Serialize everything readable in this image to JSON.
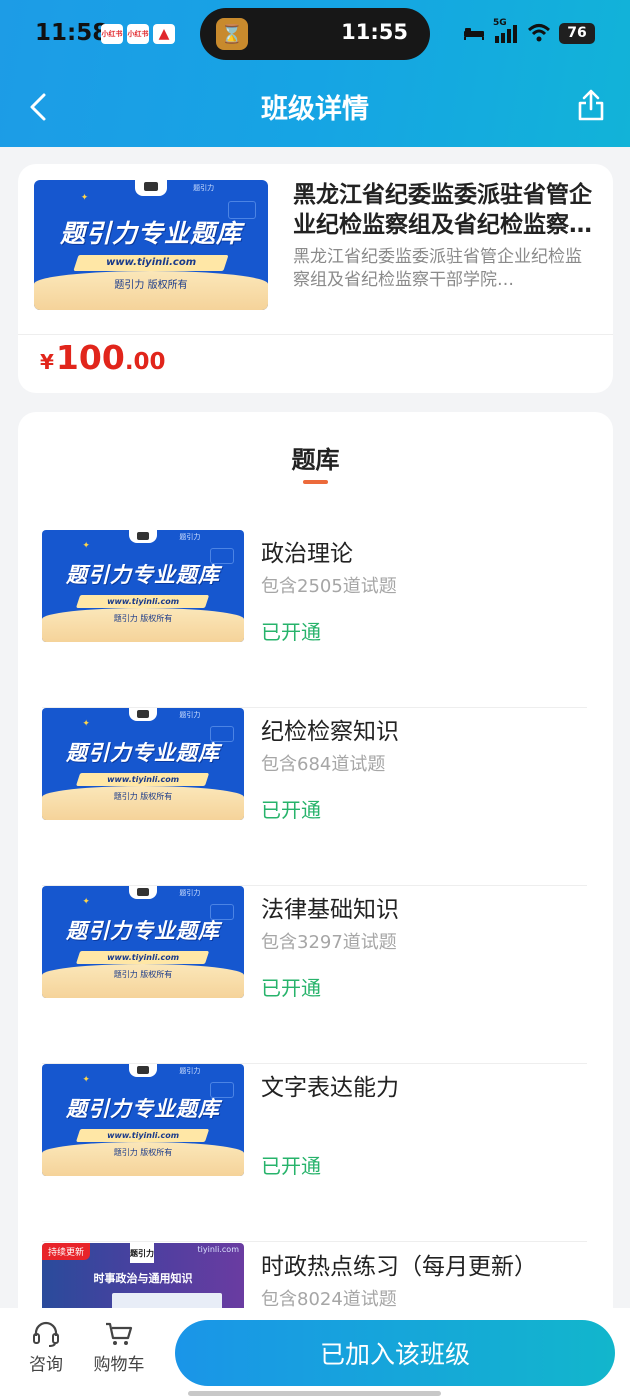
{
  "status_bar": {
    "time": "11:58",
    "mini_app_1": "小红书",
    "mini_app_2": "小红书",
    "island_time": "11:55",
    "network": "5G",
    "battery": "76"
  },
  "header": {
    "title": "班级详情"
  },
  "course": {
    "title": "黑龙江省纪委监委派驻省管企业纪检监察组及省纪检监察干部学院…",
    "description": "黑龙江省纪委监委派驻省管企业纪检监察组及省纪检监察干部学院…",
    "price_symbol": "¥",
    "price_integer": "100",
    "price_decimal": ".00"
  },
  "thumbnail": {
    "main_text": "题引力专业题库",
    "url": "www.tiyinli.com",
    "copyright": "题引力 版权所有",
    "brand": "题引力"
  },
  "question_bank": {
    "title": "题库",
    "items": [
      {
        "name": "政治理论",
        "count": "包含2505道试题",
        "state": "已开通"
      },
      {
        "name": "纪检检察知识",
        "count": "包含684道试题",
        "state": "已开通"
      },
      {
        "name": "法律基础知识",
        "count": "包含3297道试题",
        "state": "已开通"
      },
      {
        "name": "文字表达能力",
        "count": "",
        "state": "已开通"
      },
      {
        "name": "时政热点练习（每月更新）",
        "count": "包含8024道试题",
        "state": ""
      }
    ],
    "shizheng_thumb": {
      "badge": "持续更新",
      "logo": "题引力",
      "site": "tiyinli.com",
      "title": "时事政治与通用知识"
    }
  },
  "bottom_bar": {
    "consult_label": "咨询",
    "cart_label": "购物车",
    "join_label": "已加入该班级"
  },
  "colors": {
    "header_start": "#1d9ce6",
    "header_end": "#12b3d8",
    "price": "#e1251b",
    "opened": "#27b36b",
    "accent_underline": "#ec6a3b"
  }
}
